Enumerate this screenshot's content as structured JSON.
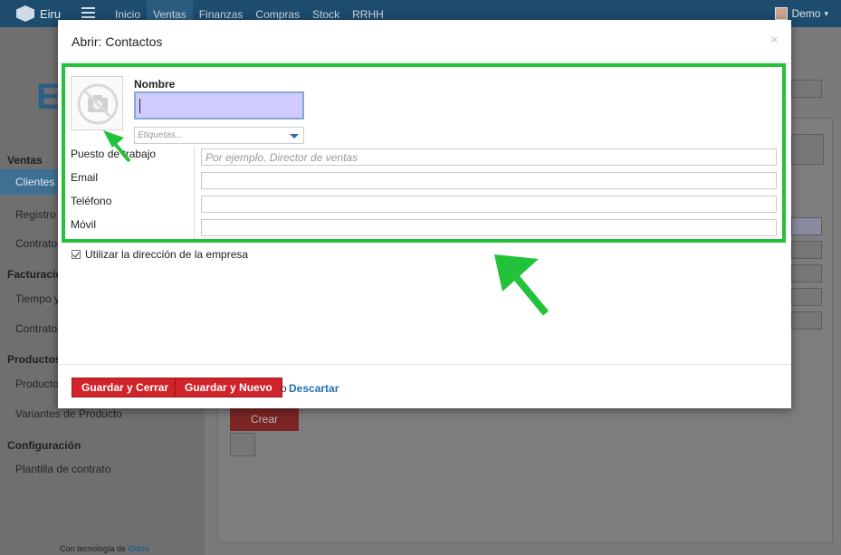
{
  "app": {
    "brand": "Eiru",
    "nav": [
      "Inicio",
      "Ventas",
      "Finanzas",
      "Compras",
      "Stock",
      "RRHH"
    ],
    "active_nav_index": 1,
    "user": "Demo"
  },
  "sidebar": {
    "brand_partial": "E",
    "sections": [
      {
        "title": "Ventas",
        "items": [
          "Clientes",
          "Registro",
          "Contratos"
        ]
      },
      {
        "title": "Facturación",
        "items": [
          "Tiempo y",
          "Contratos"
        ]
      },
      {
        "title": "Productos",
        "items": [
          "Producto",
          "Variantes de Producto"
        ]
      },
      {
        "title": "Configuración",
        "items": [
          "Plantilla de contrato"
        ]
      }
    ],
    "footer_prefix": "Con tecnología de",
    "footer_brand": "Odoo"
  },
  "background": {
    "create_label": "Crear"
  },
  "modal": {
    "title": "Abrir: Contactos",
    "close_symbol": "×",
    "name_label": "Nombre",
    "tags_placeholder": "Etiquetas...",
    "fields": [
      {
        "label": "Puesto de trabajo",
        "placeholder": "Por ejemplo, Director de ventas"
      },
      {
        "label": "Email",
        "placeholder": ""
      },
      {
        "label": "Teléfono",
        "placeholder": ""
      },
      {
        "label": "Móvil",
        "placeholder": ""
      }
    ],
    "use_company_address": "Utilizar la dirección de la empresa",
    "save_close": "Guardar y Cerrar",
    "save_new": "Guardar y Nuevo",
    "or": "o",
    "discard": "Descartar"
  },
  "colors": {
    "topbar": "#1d4c6e",
    "highlight": "#22c23a",
    "primary_button": "#d0232a",
    "link": "#2470b3",
    "name_input_bg": "#cfcbff"
  },
  "icons": [
    "no-photo-camera-icon",
    "chevron-down-icon",
    "close-icon",
    "checkbox-icon",
    "green-arrow-annotation"
  ]
}
